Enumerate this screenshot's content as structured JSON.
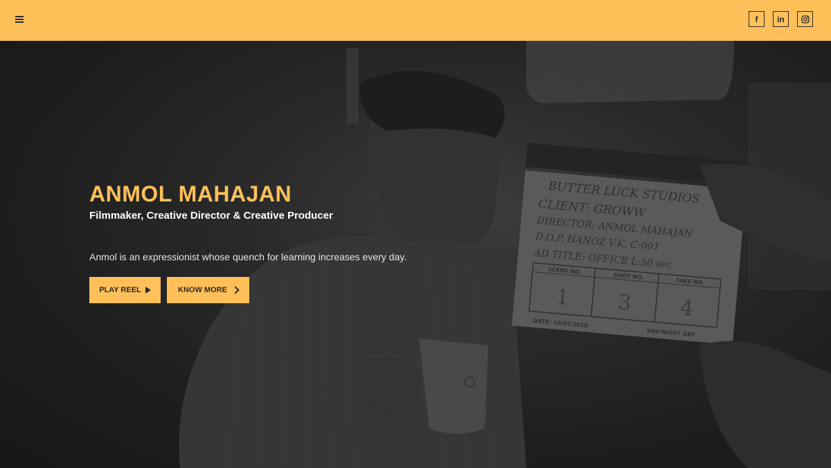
{
  "header": {
    "menu_icon": "hamburger-menu-icon",
    "social": [
      {
        "name": "facebook",
        "icon": "facebook-icon",
        "glyph": "f"
      },
      {
        "name": "linkedin",
        "icon": "linkedin-icon",
        "glyph": "in"
      },
      {
        "name": "instagram",
        "icon": "instagram-icon",
        "glyph": ""
      }
    ],
    "bar_color": "#ffc05a"
  },
  "hero": {
    "name": "ANMOL MAHAJAN",
    "subtitle": "Filmmaker, Creative Director & Creative Producer",
    "intro": "Anmol is an expressionist whose quench for learning increases every day.",
    "buttons": {
      "play_reel": "PLAY REEL",
      "know_more": "KNOW MORE"
    },
    "accent_color": "#ffc05a",
    "background_photo": {
      "description_icon": "background-photo",
      "clapperboard": {
        "line1": "BUTTER LUCK STUDIOS",
        "line2": "CLIENT: GROWW",
        "line3": "DIRECTOR: ANMOL MAHAJAN",
        "line4": "D.O.P. HANOZ V.K.   C:001",
        "line5": "AD TITLE: OFFICE   L:50 sec",
        "scene_label": "SCENE NO.",
        "shot_label": "SHOT NO.",
        "take_label": "TAKE NO.",
        "scene": "1",
        "shot": "3",
        "take": "4",
        "date_label": "DATE: 10/07/2019",
        "daynight_label": "DAY/NIGHT  DAY"
      }
    }
  }
}
